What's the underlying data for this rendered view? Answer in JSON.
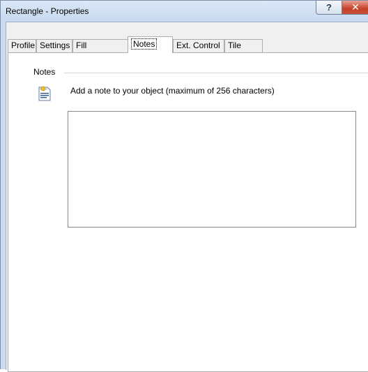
{
  "window": {
    "title": "Rectangle - Properties",
    "help_label": "?",
    "close_label": "✕"
  },
  "tabs": [
    {
      "label": "Profile"
    },
    {
      "label": "Settings"
    },
    {
      "label": "Fill"
    },
    {
      "label": "Notes",
      "active": true
    },
    {
      "label": "Ext. Control"
    },
    {
      "label": "Tile"
    }
  ],
  "notes": {
    "group_label": "Notes",
    "hint": "Add a note to your object  (maximum of 256 characters)",
    "value": "",
    "icon": "note-document-icon"
  },
  "colors": {
    "frame": "#c9dcf0",
    "close_button": "#c7412a",
    "panel": "#ffffff"
  }
}
